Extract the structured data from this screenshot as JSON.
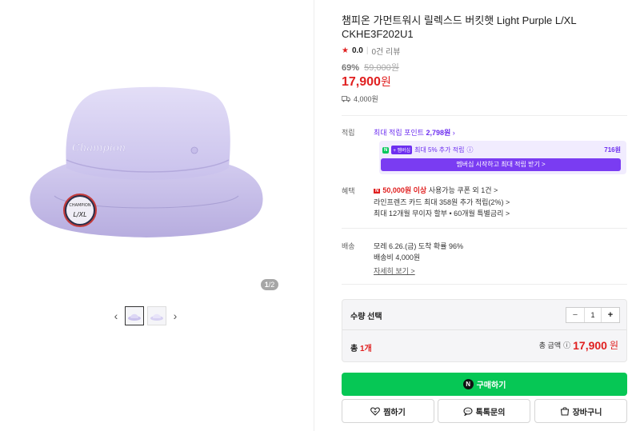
{
  "gallery": {
    "counter_current": "1",
    "counter_total": "/2",
    "prev_arrow": "‹",
    "next_arrow": "›"
  },
  "product": {
    "title": "챔피온 가먼트워시 릴렉스드 버킷햇 Light Purple L/XL CKHE3F202U1",
    "rating": "0.0",
    "reviews": "0건 리뷰",
    "discount": "69%",
    "original_price": "59,000원",
    "price": "17,900",
    "price_unit": "원",
    "shipping_fee": "4,000원"
  },
  "points": {
    "label": "적립",
    "max_prefix": "최대 적립 포인트",
    "max_amount": "2,798원",
    "member_badge_n": "N",
    "member_badge_plus": "+ 멤버십",
    "member_text": "최대 5% 추가 적립",
    "member_amount": "716원",
    "member_button": "멤버십 시작하고 최대 적립 받기 >"
  },
  "benefits": {
    "label": "혜택",
    "coupon_badge": "N",
    "coupon_red": "50,000원 이상",
    "coupon_rest": "사용가능 쿠폰 외 1건 >",
    "card_line": "라인프렌즈 카드 최대 358원 추가 적립(2%) >",
    "installment_line": "최대 12개월 무이자 할부 • 60개월 특별금리 >"
  },
  "delivery": {
    "label": "배송",
    "arrival": "모레 6.26.(금) 도착 확률 96%",
    "fee": "배송비 4,000원",
    "detail_link": "자세히 보기 >"
  },
  "quantity": {
    "label": "수량 선택",
    "minus": "−",
    "value": "1",
    "plus": "+",
    "total_prefix": "총",
    "total_count": "1개",
    "total_amount_label": "총 금액",
    "total_amount": "17,900",
    "total_unit": "원"
  },
  "actions": {
    "buy_icon": "N",
    "buy": "구매하기",
    "wish": "찜하기",
    "talk": "톡톡문의",
    "cart": "장바구니"
  },
  "colors": {
    "accent_red": "#e02020",
    "naver_green": "#06c755",
    "membership_purple": "#6d2ef0"
  }
}
